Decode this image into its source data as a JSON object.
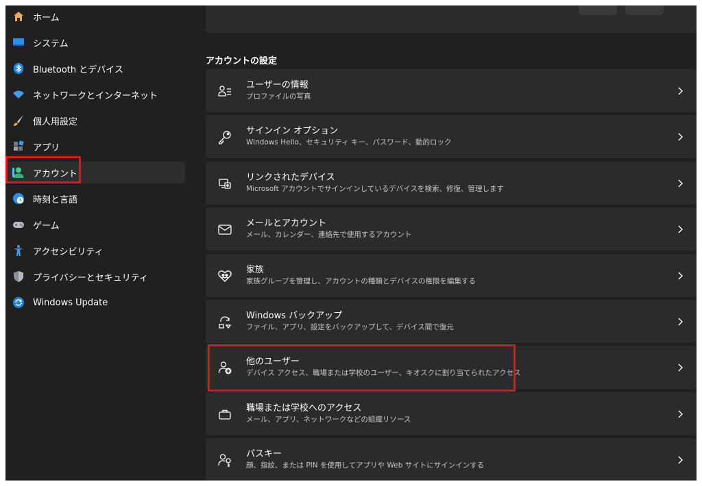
{
  "sidebar": {
    "items": [
      {
        "label": "ホーム",
        "icon": "home-icon"
      },
      {
        "label": "システム",
        "icon": "system-icon"
      },
      {
        "label": "Bluetooth とデバイス",
        "icon": "bluetooth-icon"
      },
      {
        "label": "ネットワークとインターネット",
        "icon": "wifi-icon"
      },
      {
        "label": "個人用設定",
        "icon": "brush-icon"
      },
      {
        "label": "アプリ",
        "icon": "apps-icon"
      },
      {
        "label": "アカウント",
        "icon": "account-icon"
      },
      {
        "label": "時刻と言語",
        "icon": "time-language-icon"
      },
      {
        "label": "ゲーム",
        "icon": "gamepad-icon"
      },
      {
        "label": "アクセシビリティ",
        "icon": "accessibility-icon"
      },
      {
        "label": "プライバシーとセキュリティ",
        "icon": "shield-icon"
      },
      {
        "label": "Windows Update",
        "icon": "update-icon"
      }
    ],
    "selected_index": 6
  },
  "main": {
    "section_title": "アカウントの設定",
    "rows": [
      {
        "title": "ユーザーの情報",
        "sub": "プロファイルの写真",
        "icon": "user-info-icon"
      },
      {
        "title": "サインイン オプション",
        "sub": "Windows Hello、セキュリティ キー、パスワード、動的ロック",
        "icon": "key-icon"
      },
      {
        "title": "リンクされたデバイス",
        "sub": "Microsoft アカウントでサインインしているデバイスを検索、修復、管理します",
        "icon": "linked-devices-icon"
      },
      {
        "title": "メールとアカウント",
        "sub": "メール、カレンダー、連絡先で使用するアカウント",
        "icon": "mail-icon"
      },
      {
        "title": "家族",
        "sub": "家族グループを管理し、アカウントの種類とデバイスの権限を編集する",
        "icon": "family-heart-icon"
      },
      {
        "title": "Windows バックアップ",
        "sub": "ファイル、アプリ、設定をバックアップして、デバイス間で復元",
        "icon": "backup-icon"
      },
      {
        "title": "他のユーザー",
        "sub": "デバイス アクセス、職場または学校のユーザー、キオスクに割り当てられたアクセス",
        "icon": "add-user-icon"
      },
      {
        "title": "職場または学校へのアクセス",
        "sub": "メール、アプリ、ネットワークなどの組織リソース",
        "icon": "briefcase-icon"
      },
      {
        "title": "パスキー",
        "sub": "顔、指紋、または PIN を使用してアプリや Web サイトにサインインする",
        "icon": "passkey-icon"
      }
    ]
  },
  "colors": {
    "background": "#202020",
    "card": "#2b2b2b",
    "accent": "#4cc2ff",
    "highlight": "#e01515"
  }
}
